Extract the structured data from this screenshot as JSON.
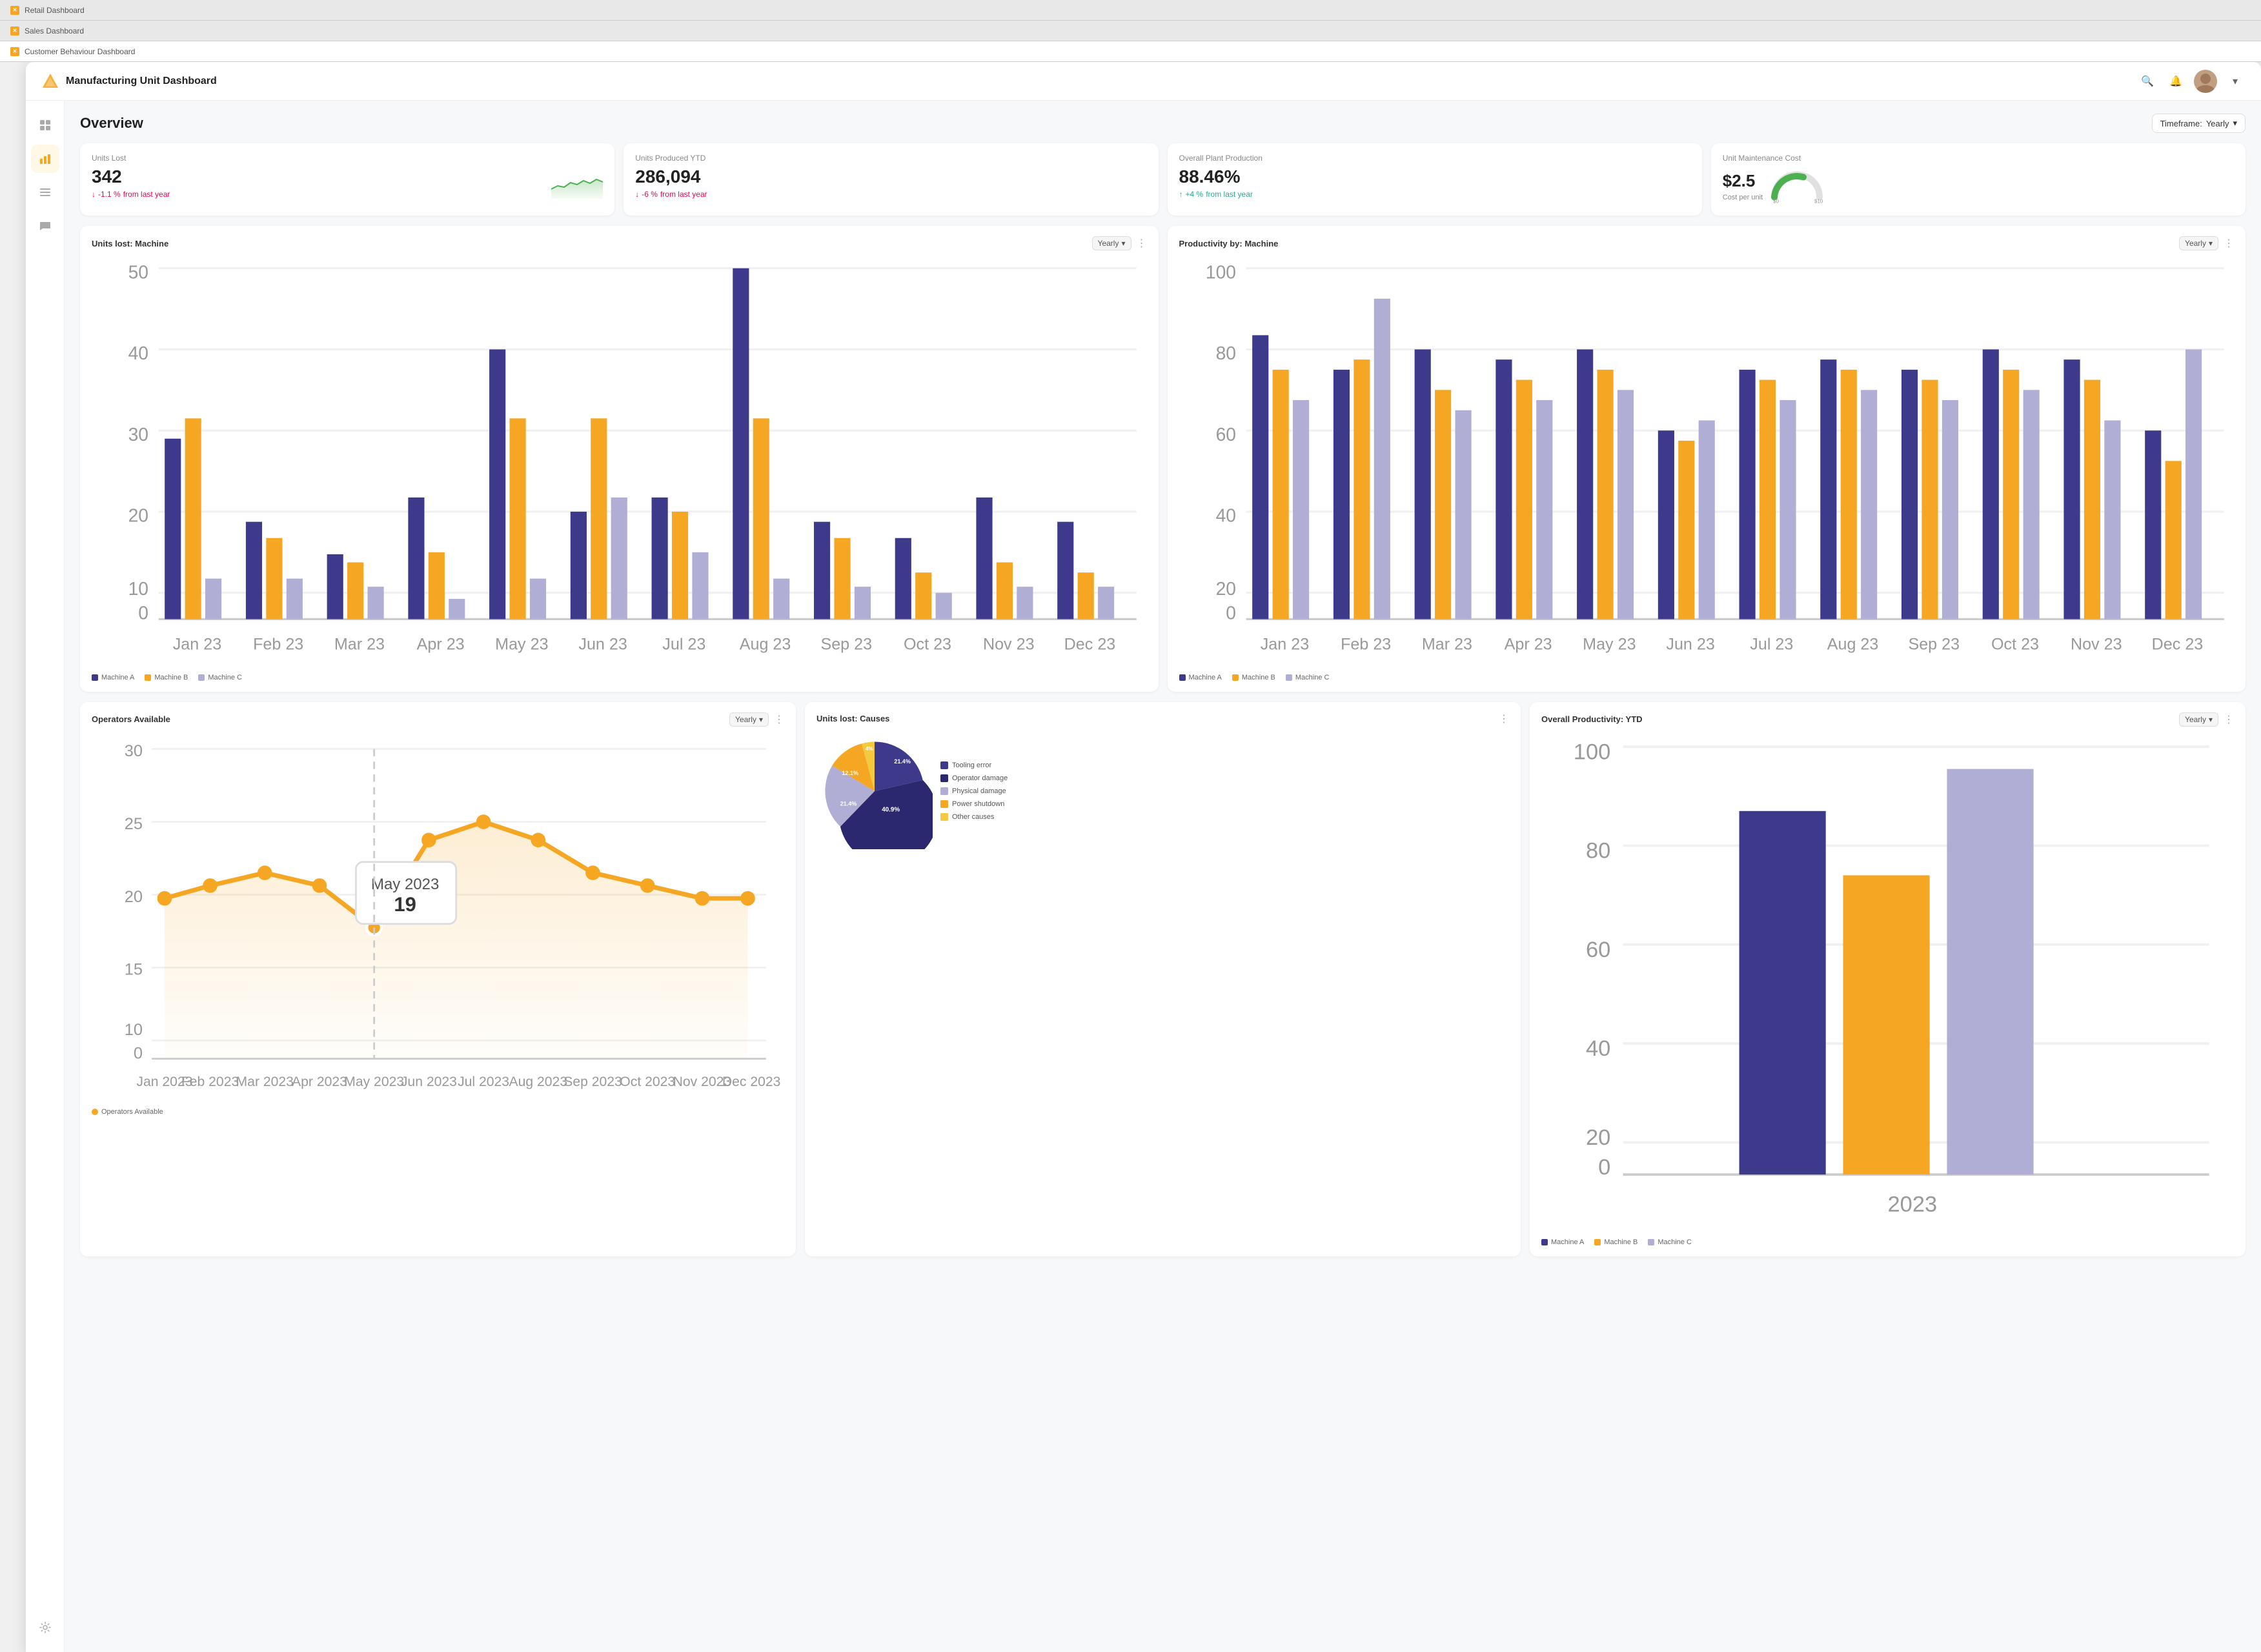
{
  "browser": {
    "tabs": [
      {
        "label": "Retail Dashboard",
        "active": false
      },
      {
        "label": "Sales Dashboard",
        "active": false
      },
      {
        "label": "Customer Behaviour Dashboard",
        "active": true
      }
    ]
  },
  "topbar": {
    "title": "Manufacturing Unit Dashboard",
    "timeframe_label": "Timeframe:",
    "timeframe_value": "Yearly"
  },
  "sidebar": {
    "items": [
      {
        "name": "grid-icon",
        "symbol": "⊞",
        "active": false
      },
      {
        "name": "chart-icon",
        "symbol": "📊",
        "active": true
      },
      {
        "name": "list-icon",
        "symbol": "☰",
        "active": false
      },
      {
        "name": "message-icon",
        "symbol": "💬",
        "active": false
      }
    ],
    "bottom": [
      {
        "name": "settings-icon",
        "symbol": "⚙",
        "active": false
      }
    ]
  },
  "overview": {
    "title": "Overview",
    "timeframe_label": "Timeframe:",
    "timeframe_value": "Yearly"
  },
  "kpis": [
    {
      "label": "Units Lost",
      "value": "342",
      "change": "-1.1 %",
      "change_suffix": "from last year",
      "direction": "negative",
      "has_sparkline": true
    },
    {
      "label": "Units Produced YTD",
      "value": "286,094",
      "change": "-6 %",
      "change_suffix": "from last year",
      "direction": "negative",
      "has_sparkline": false
    },
    {
      "label": "Overall Plant Production",
      "value": "88.46%",
      "change": "+4 %",
      "change_suffix": "from last year",
      "direction": "positive",
      "has_sparkline": false
    },
    {
      "label": "Unit Maintenance Cost",
      "value": "$2.5",
      "cost_label": "Cost per unit",
      "has_gauge": true
    }
  ],
  "charts": {
    "units_lost_machine": {
      "title": "Units lost: Machine",
      "timeframe": "Yearly",
      "months": [
        "Jan 23",
        "Feb 23",
        "Mar 23",
        "Apr 23",
        "May 23",
        "Jun 23",
        "Jul 23",
        "Aug 23",
        "Sep 23",
        "Oct 23",
        "Nov 23",
        "Dec 23"
      ],
      "series": [
        {
          "name": "Machine A",
          "color": "#3d3a8c"
        },
        {
          "name": "Machine B",
          "color": "#f5a623"
        },
        {
          "name": "Machine C",
          "color": "#b0aed4"
        }
      ]
    },
    "productivity_machine": {
      "title": "Productivity by: Machine",
      "timeframe": "Yearly",
      "months": [
        "Jan 23",
        "Feb 23",
        "Mar 23",
        "Apr 23",
        "May 23",
        "Jun 23",
        "Jul 23",
        "Aug 23",
        "Sep 23",
        "Oct 23",
        "Nov 23",
        "Dec 23"
      ],
      "series": [
        {
          "name": "Machine A",
          "color": "#3d3a8c"
        },
        {
          "name": "Machine B",
          "color": "#f5a623"
        },
        {
          "name": "Machine C",
          "color": "#b0aed4"
        }
      ]
    },
    "operators_available": {
      "title": "Operators Available",
      "timeframe": "Yearly",
      "tooltip_month": "May 2023",
      "tooltip_value": "19",
      "legend_label": "Operators Available",
      "legend_color": "#f5a623"
    },
    "units_lost_causes": {
      "title": "Units lost: Causes",
      "segments": [
        {
          "label": "Tooling error",
          "value": 21.4,
          "color": "#3d3a8c"
        },
        {
          "label": "Operator damage",
          "value": 40.9,
          "color": "#2b2870"
        },
        {
          "label": "Physical damage",
          "value": 21.4,
          "color": "#b0aed4"
        },
        {
          "label": "Power shutdown",
          "value": 12.1,
          "color": "#f5a623"
        },
        {
          "label": "Other causes",
          "value": 4.2,
          "color": "#f5c842"
        }
      ]
    },
    "overall_productivity": {
      "title": "Overall Productivity: YTD",
      "timeframe": "Yearly",
      "year_label": "2023",
      "bars": [
        {
          "label": "Machine A",
          "value": 85,
          "color": "#3d3a8c"
        },
        {
          "label": "Machine B",
          "value": 70,
          "color": "#f5a623"
        },
        {
          "label": "Machine C",
          "value": 95,
          "color": "#b0aed4"
        }
      ],
      "series": [
        {
          "name": "Machine A",
          "color": "#3d3a8c"
        },
        {
          "name": "Machine B",
          "color": "#f5a623"
        },
        {
          "name": "Machine C",
          "color": "#b0aed4"
        }
      ]
    }
  },
  "icons": {
    "search": "🔍",
    "bell": "🔔",
    "chevron_down": "▾",
    "three_dots": "⋮",
    "arrow_down": "↓",
    "arrow_up": "↑"
  }
}
